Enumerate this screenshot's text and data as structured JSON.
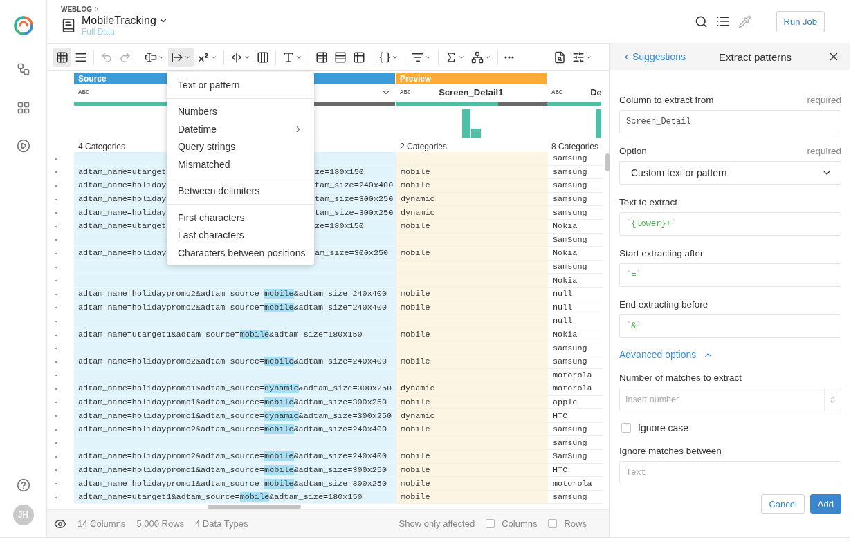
{
  "rail": {
    "avatar": "JH"
  },
  "header": {
    "breadcrumb": "WEBLOG",
    "title": "MobileTracking",
    "subtitle": "Full Data",
    "run_button": "Run Job"
  },
  "toolbar": [
    {
      "kind": "grid",
      "selected": true,
      "disabled": false,
      "caret": false
    },
    {
      "kind": "list",
      "selected": false,
      "disabled": false,
      "caret": false
    },
    {
      "kind": "divider"
    },
    {
      "kind": "undo",
      "selected": false,
      "disabled": true,
      "caret": false
    },
    {
      "kind": "redo",
      "selected": false,
      "disabled": true,
      "caret": false
    },
    {
      "kind": "divider"
    },
    {
      "kind": "letters",
      "selected": false,
      "disabled": false,
      "caret": true
    },
    {
      "kind": "extract",
      "selected": true,
      "disabled": false,
      "caret": true
    },
    {
      "kind": "count",
      "selected": false,
      "disabled": false,
      "caret": true
    },
    {
      "kind": "divider"
    },
    {
      "kind": "split",
      "selected": false,
      "disabled": false,
      "caret": true
    },
    {
      "kind": "merge",
      "selected": false,
      "disabled": false,
      "caret": false
    },
    {
      "kind": "divider"
    },
    {
      "kind": "format",
      "selected": false,
      "disabled": false,
      "caret": true
    },
    {
      "kind": "divider"
    },
    {
      "kind": "table-a",
      "selected": false,
      "disabled": false,
      "caret": false
    },
    {
      "kind": "table-b",
      "selected": false,
      "disabled": false,
      "caret": false
    },
    {
      "kind": "table-c",
      "selected": false,
      "disabled": false,
      "caret": false
    },
    {
      "kind": "divider"
    },
    {
      "kind": "braces",
      "selected": false,
      "disabled": false,
      "caret": true
    },
    {
      "kind": "divider"
    },
    {
      "kind": "filter",
      "selected": false,
      "disabled": false,
      "caret": true
    },
    {
      "kind": "divider"
    },
    {
      "kind": "sigma",
      "selected": false,
      "disabled": false,
      "caret": true
    },
    {
      "kind": "tree",
      "selected": false,
      "disabled": false,
      "caret": true
    },
    {
      "kind": "divider"
    },
    {
      "kind": "more",
      "selected": false,
      "disabled": false,
      "caret": false
    },
    {
      "kind": "find",
      "selected": false,
      "disabled": false,
      "caret": false
    },
    {
      "kind": "settings",
      "selected": false,
      "disabled": false,
      "caret": true
    }
  ],
  "columns": [
    {
      "kind": "source",
      "group": "Source",
      "color": "#3d9bd8",
      "type": "ABC",
      "dropdown": true,
      "level": 0.72,
      "categories": "4 Categories"
    },
    {
      "kind": "preview",
      "group": "Preview",
      "color": "#fbab36",
      "type": "ABC",
      "name": "Screen_Detail1",
      "dropdown": false,
      "level": 0.68,
      "categories": "2 Categories"
    },
    {
      "kind": "plain",
      "type": "ABC",
      "name": "De",
      "dropdown": false,
      "level": 1,
      "categories": "8 Categories"
    }
  ],
  "rows": [
    {
      "column_3": "samsung"
    },
    {
      "source": {
        "kind": "covered",
        "start": "adtam_name=utarget",
        "end": "ze=180x150"
      },
      "preview": "mobile",
      "column_3": "samsung"
    },
    {
      "source": {
        "kind": "covered",
        "start": "adtam_name=holiday",
        "end": "tam_size=240x400"
      },
      "preview": "mobile",
      "column_3": "samsung"
    },
    {
      "source": {
        "kind": "covered",
        "start": "adtam_name=holiday",
        "end": "tam_size=300x250"
      },
      "preview": "dynamic",
      "column_3": "samsung"
    },
    {
      "source": {
        "kind": "covered",
        "start": "adtam_name=holiday",
        "end": "tam_size=300x250"
      },
      "preview": "dynamic",
      "column_3": "samsung"
    },
    {
      "source": {
        "kind": "covered",
        "start": "adtam_name=utarget",
        "end": "ze=180x150"
      },
      "preview": "mobile",
      "column_3": "Nokia"
    },
    {
      "column_3": "SamSung"
    },
    {
      "source": {
        "kind": "covered",
        "start": "adtam_name=holiday",
        "end": "am_size=300x250"
      },
      "preview": "mobile",
      "column_3": "Nokia"
    },
    {
      "column_3": "samsung"
    },
    {
      "column_3": "Nokia"
    },
    {
      "source": {
        "kind": "match",
        "before": "adtam_name=holidaypromo2&adtam_source=",
        "match": "mobile",
        "after": "&adtam_size=240x400"
      },
      "preview": "mobile",
      "column_3": "null"
    },
    {
      "source": {
        "kind": "match",
        "before": "adtam_name=holidaypromo2&adtam_source=",
        "match": "mobile",
        "after": "&adtam_size=240x400"
      },
      "preview": "mobile",
      "column_3": "null"
    },
    {
      "column_3": "null"
    },
    {
      "source": {
        "kind": "match",
        "before": "adtam_name=utarget1&adtam_source=",
        "match": "mobile",
        "after": "&adtam_size=180x150"
      },
      "preview": "mobile",
      "column_3": "Nokia"
    },
    {
      "column_3": "samsung"
    },
    {
      "source": {
        "kind": "match",
        "before": "adtam_name=holidaypromo2&adtam_source=",
        "match": "mobile",
        "after": "&adtam_size=240x400"
      },
      "preview": "mobile",
      "column_3": "samsung"
    },
    {
      "column_3": "motorola"
    },
    {
      "source": {
        "kind": "match",
        "before": "adtam_name=holidaypromo1&adtam_source=",
        "match": "dynamic",
        "after": "&adtam_size=300x250"
      },
      "preview": "dynamic",
      "column_3": "motorola"
    },
    {
      "source": {
        "kind": "match",
        "before": "adtam_name=holidaypromo1&adtam_source=",
        "match": "mobile",
        "after": "&adtam_size=300x250"
      },
      "preview": "mobile",
      "column_3": "apple"
    },
    {
      "source": {
        "kind": "match",
        "before": "adtam_name=holidaypromo1&adtam_source=",
        "match": "dynamic",
        "after": "&adtam_size=300x250"
      },
      "preview": "dynamic",
      "column_3": "HTC"
    },
    {
      "source": {
        "kind": "match",
        "before": "adtam_name=holidaypromo2&adtam_source=",
        "match": "mobile",
        "after": "&adtam_size=240x400"
      },
      "preview": "mobile",
      "column_3": "samsung"
    },
    {
      "column_3": "samsung"
    },
    {
      "source": {
        "kind": "match",
        "before": "adtam_name=holidaypromo2&adtam_source=",
        "match": "mobile",
        "after": "&adtam_size=240x400"
      },
      "preview": "mobile",
      "column_3": "SamSung"
    },
    {
      "source": {
        "kind": "match",
        "before": "adtam_name=holidaypromo1&adtam_source=",
        "match": "mobile",
        "after": "&adtam_size=300x250"
      },
      "preview": "mobile",
      "column_3": "HTC"
    },
    {
      "source": {
        "kind": "match",
        "before": "adtam_name=holidaypromo1&adtam_source=",
        "match": "mobile",
        "after": "&adtam_size=300x250"
      },
      "preview": "mobile",
      "column_3": "motorola"
    },
    {
      "source": {
        "kind": "match",
        "before": "adtam_name=utarget1&adtam_source=",
        "match": "mobile",
        "after": "&adtam_size=180x150"
      },
      "preview": "mobile",
      "column_3": "samsung"
    }
  ],
  "menu": [
    [
      {
        "label": "Text or pattern",
        "submenu": false
      }
    ],
    [
      {
        "label": "Numbers",
        "submenu": false
      },
      {
        "label": "Datetime",
        "submenu": true
      },
      {
        "label": "Query strings",
        "submenu": false
      },
      {
        "label": "Mismatched",
        "submenu": false
      }
    ],
    [
      {
        "label": "Between delimiters",
        "submenu": false
      }
    ],
    [
      {
        "label": "First characters",
        "submenu": false
      },
      {
        "label": "Last characters",
        "submenu": false
      },
      {
        "label": "Characters between positions",
        "submenu": false
      }
    ]
  ],
  "status_bar": {
    "stats": [
      "14 Columns",
      "5,000 Rows",
      "4 Data Types"
    ],
    "filter_label": "Show only affected",
    "filters": [
      {
        "label": "Columns",
        "checked": false
      },
      {
        "label": "Rows",
        "checked": false
      }
    ]
  },
  "panel": {
    "back": "Suggestions",
    "title": "Extract patterns",
    "fields": [
      {
        "kind": "text",
        "label": "Column to extract from",
        "required": "required",
        "value": "Screen_Detail"
      },
      {
        "kind": "select",
        "label": "Option",
        "required": "required",
        "value": "Custom text or pattern"
      },
      {
        "kind": "pattern",
        "label": "Text to extract",
        "value": "`{lower}+`"
      },
      {
        "kind": "pattern",
        "label": "Start extracting after",
        "value": "`=`"
      },
      {
        "kind": "pattern",
        "label": "End extracting before",
        "value": "`&`"
      },
      {
        "kind": "toggle",
        "label": "Advanced options",
        "expanded": true
      },
      {
        "kind": "number",
        "label": "Number of matches to extract",
        "placeholder": "Insert number"
      },
      {
        "kind": "checkbox",
        "label": "Ignore case",
        "checked": false
      },
      {
        "kind": "text",
        "label": "Ignore matches between",
        "placeholder": "Text"
      }
    ],
    "actions": [
      "Cancel",
      "Add"
    ]
  }
}
